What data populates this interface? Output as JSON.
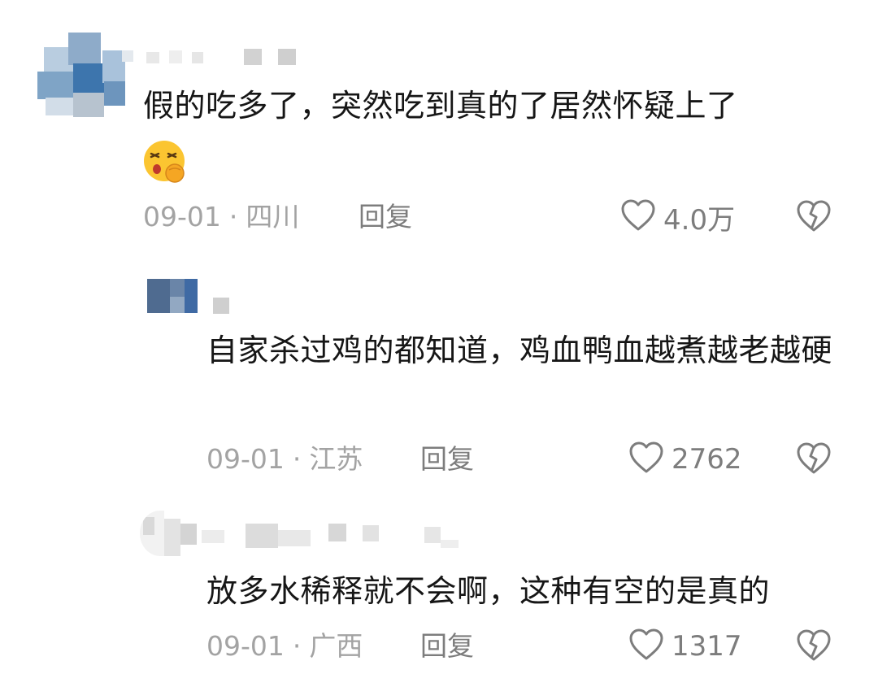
{
  "comments": [
    {
      "text": "假的吃多了，突然吃到真的了居然怀疑上了",
      "emoji": "smirking-hand-over-mouth-emoji",
      "date": "09-01",
      "separator": "·",
      "location": "四川",
      "reply_label": "回复",
      "likes": "4.0万"
    },
    {
      "text": "自家杀过鸡的都知道，鸡血鸭血越煮越老越硬",
      "date": "09-01",
      "separator": "·",
      "location": "江苏",
      "reply_label": "回复",
      "likes": "2762"
    },
    {
      "text": "放多水稀释就不会啊，这种有空的是真的",
      "date": "09-01",
      "separator": "·",
      "location": "广西",
      "reply_label": "回复",
      "likes": "1317"
    }
  ],
  "icons": {
    "like": "heart-outline-icon",
    "dislike": "broken-heart-icon"
  },
  "colors": {
    "text": "#161616",
    "meta": "#a3a3a3",
    "action": "#7d7d7d",
    "background": "#ffffff"
  }
}
